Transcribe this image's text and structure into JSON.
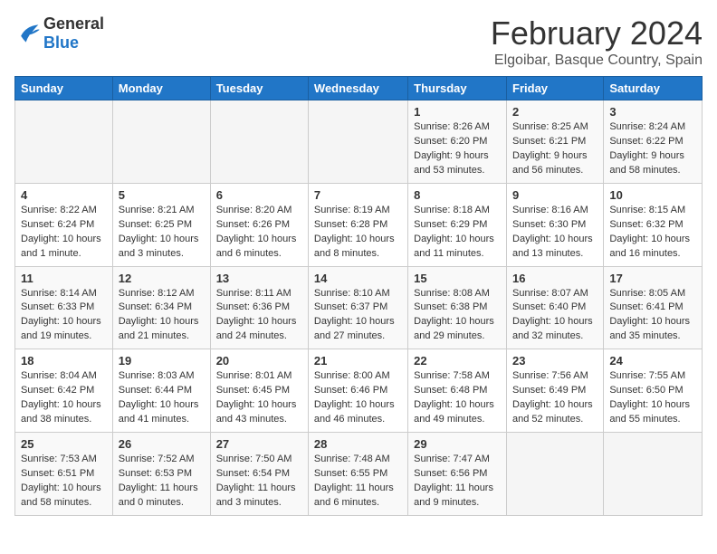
{
  "header": {
    "logo": {
      "general": "General",
      "blue": "Blue"
    },
    "title": "February 2024",
    "location": "Elgoibar, Basque Country, Spain"
  },
  "columns": [
    "Sunday",
    "Monday",
    "Tuesday",
    "Wednesday",
    "Thursday",
    "Friday",
    "Saturday"
  ],
  "weeks": [
    [
      {
        "day": "",
        "info": ""
      },
      {
        "day": "",
        "info": ""
      },
      {
        "day": "",
        "info": ""
      },
      {
        "day": "",
        "info": ""
      },
      {
        "day": "1",
        "info": "Sunrise: 8:26 AM\nSunset: 6:20 PM\nDaylight: 9 hours\nand 53 minutes."
      },
      {
        "day": "2",
        "info": "Sunrise: 8:25 AM\nSunset: 6:21 PM\nDaylight: 9 hours\nand 56 minutes."
      },
      {
        "day": "3",
        "info": "Sunrise: 8:24 AM\nSunset: 6:22 PM\nDaylight: 9 hours\nand 58 minutes."
      }
    ],
    [
      {
        "day": "4",
        "info": "Sunrise: 8:22 AM\nSunset: 6:24 PM\nDaylight: 10 hours\nand 1 minute."
      },
      {
        "day": "5",
        "info": "Sunrise: 8:21 AM\nSunset: 6:25 PM\nDaylight: 10 hours\nand 3 minutes."
      },
      {
        "day": "6",
        "info": "Sunrise: 8:20 AM\nSunset: 6:26 PM\nDaylight: 10 hours\nand 6 minutes."
      },
      {
        "day": "7",
        "info": "Sunrise: 8:19 AM\nSunset: 6:28 PM\nDaylight: 10 hours\nand 8 minutes."
      },
      {
        "day": "8",
        "info": "Sunrise: 8:18 AM\nSunset: 6:29 PM\nDaylight: 10 hours\nand 11 minutes."
      },
      {
        "day": "9",
        "info": "Sunrise: 8:16 AM\nSunset: 6:30 PM\nDaylight: 10 hours\nand 13 minutes."
      },
      {
        "day": "10",
        "info": "Sunrise: 8:15 AM\nSunset: 6:32 PM\nDaylight: 10 hours\nand 16 minutes."
      }
    ],
    [
      {
        "day": "11",
        "info": "Sunrise: 8:14 AM\nSunset: 6:33 PM\nDaylight: 10 hours\nand 19 minutes."
      },
      {
        "day": "12",
        "info": "Sunrise: 8:12 AM\nSunset: 6:34 PM\nDaylight: 10 hours\nand 21 minutes."
      },
      {
        "day": "13",
        "info": "Sunrise: 8:11 AM\nSunset: 6:36 PM\nDaylight: 10 hours\nand 24 minutes."
      },
      {
        "day": "14",
        "info": "Sunrise: 8:10 AM\nSunset: 6:37 PM\nDaylight: 10 hours\nand 27 minutes."
      },
      {
        "day": "15",
        "info": "Sunrise: 8:08 AM\nSunset: 6:38 PM\nDaylight: 10 hours\nand 29 minutes."
      },
      {
        "day": "16",
        "info": "Sunrise: 8:07 AM\nSunset: 6:40 PM\nDaylight: 10 hours\nand 32 minutes."
      },
      {
        "day": "17",
        "info": "Sunrise: 8:05 AM\nSunset: 6:41 PM\nDaylight: 10 hours\nand 35 minutes."
      }
    ],
    [
      {
        "day": "18",
        "info": "Sunrise: 8:04 AM\nSunset: 6:42 PM\nDaylight: 10 hours\nand 38 minutes."
      },
      {
        "day": "19",
        "info": "Sunrise: 8:03 AM\nSunset: 6:44 PM\nDaylight: 10 hours\nand 41 minutes."
      },
      {
        "day": "20",
        "info": "Sunrise: 8:01 AM\nSunset: 6:45 PM\nDaylight: 10 hours\nand 43 minutes."
      },
      {
        "day": "21",
        "info": "Sunrise: 8:00 AM\nSunset: 6:46 PM\nDaylight: 10 hours\nand 46 minutes."
      },
      {
        "day": "22",
        "info": "Sunrise: 7:58 AM\nSunset: 6:48 PM\nDaylight: 10 hours\nand 49 minutes."
      },
      {
        "day": "23",
        "info": "Sunrise: 7:56 AM\nSunset: 6:49 PM\nDaylight: 10 hours\nand 52 minutes."
      },
      {
        "day": "24",
        "info": "Sunrise: 7:55 AM\nSunset: 6:50 PM\nDaylight: 10 hours\nand 55 minutes."
      }
    ],
    [
      {
        "day": "25",
        "info": "Sunrise: 7:53 AM\nSunset: 6:51 PM\nDaylight: 10 hours\nand 58 minutes."
      },
      {
        "day": "26",
        "info": "Sunrise: 7:52 AM\nSunset: 6:53 PM\nDaylight: 11 hours\nand 0 minutes."
      },
      {
        "day": "27",
        "info": "Sunrise: 7:50 AM\nSunset: 6:54 PM\nDaylight: 11 hours\nand 3 minutes."
      },
      {
        "day": "28",
        "info": "Sunrise: 7:48 AM\nSunset: 6:55 PM\nDaylight: 11 hours\nand 6 minutes."
      },
      {
        "day": "29",
        "info": "Sunrise: 7:47 AM\nSunset: 6:56 PM\nDaylight: 11 hours\nand 9 minutes."
      },
      {
        "day": "",
        "info": ""
      },
      {
        "day": "",
        "info": ""
      }
    ]
  ]
}
